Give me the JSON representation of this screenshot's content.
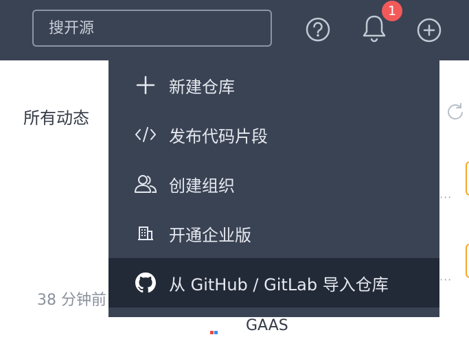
{
  "header": {
    "search_placeholder": "搜开源",
    "notification_count": "1"
  },
  "main": {
    "title": "所有动态",
    "timestamp": "38 分钟前",
    "bottom_text": "GAAS"
  },
  "create_menu": {
    "items": [
      {
        "label": "新建仓库",
        "icon": "plus-icon"
      },
      {
        "label": "发布代码片段",
        "icon": "code-icon"
      },
      {
        "label": "创建组织",
        "icon": "users-icon"
      },
      {
        "label": "开通企业版",
        "icon": "building-icon"
      },
      {
        "label": "从 GitHub / GitLab 导入仓库",
        "icon": "github-icon"
      }
    ]
  },
  "colors": {
    "topbar": "#3a4354",
    "menu_bg": "#3a4354",
    "menu_active": "#222a38",
    "badge": "#f25a5a",
    "accent": "#f5a623"
  }
}
